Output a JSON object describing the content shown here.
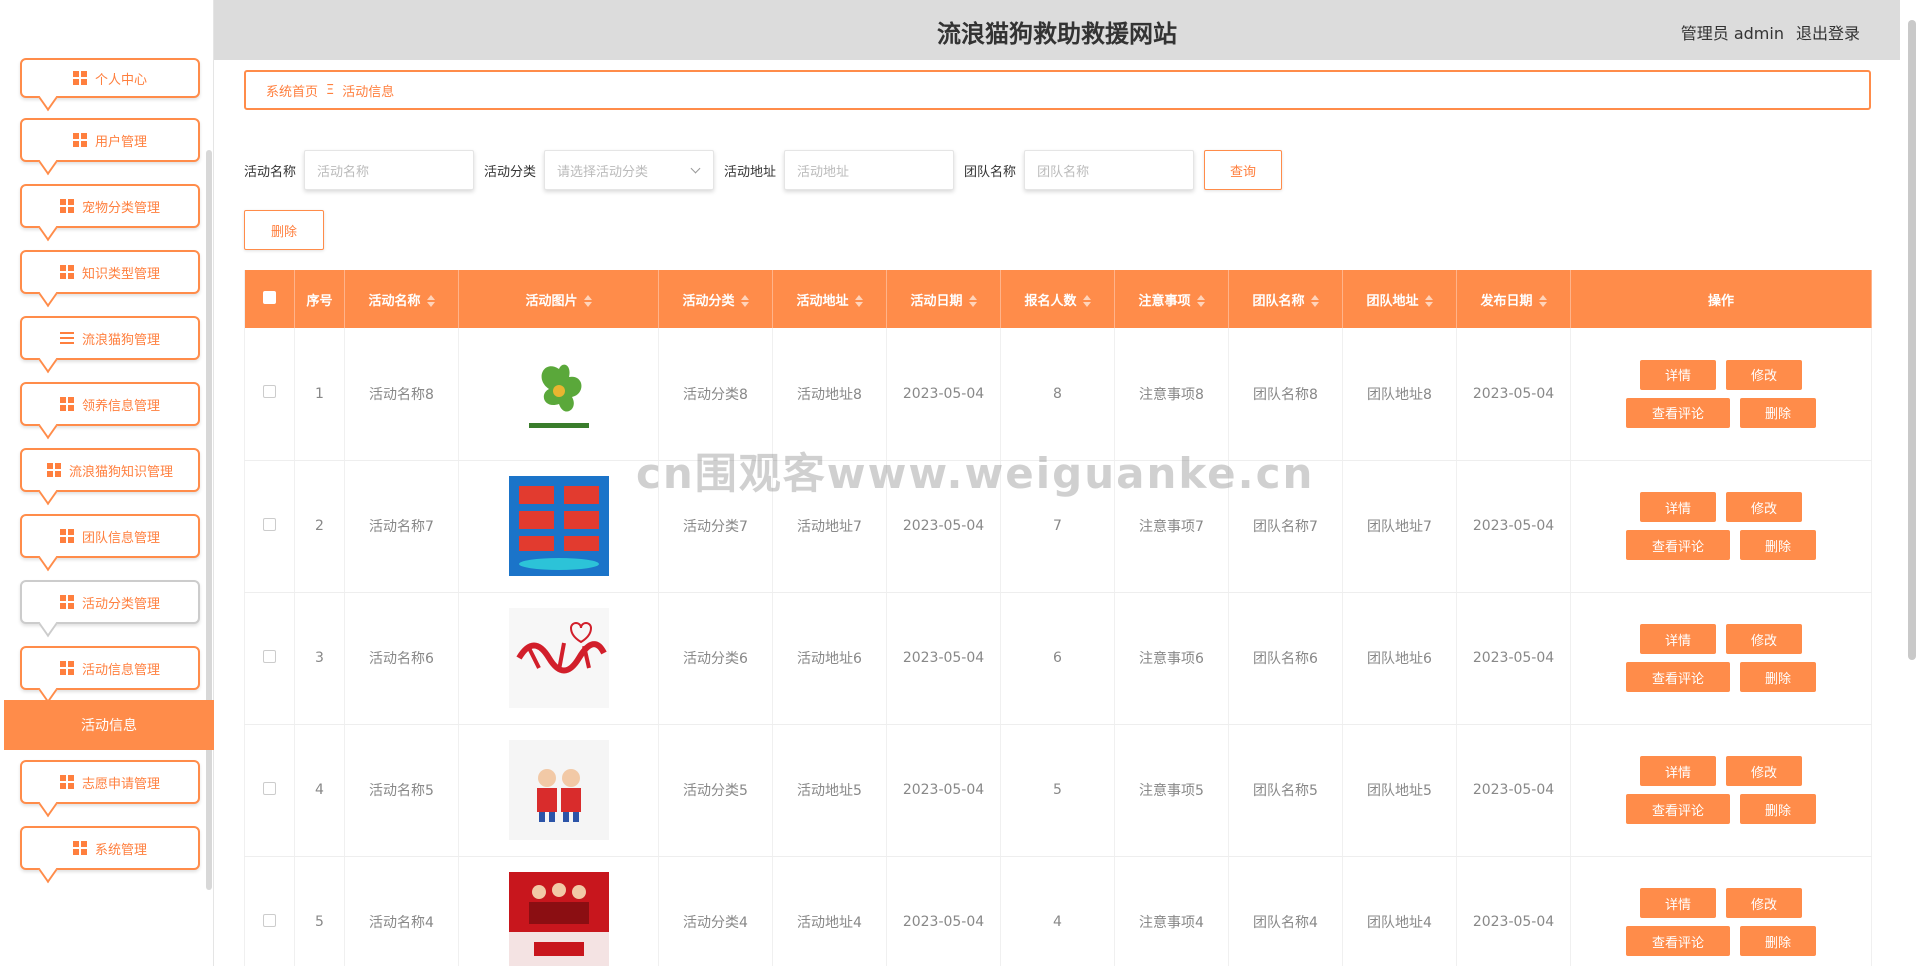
{
  "header": {
    "site_title": "流浪猫狗救助救援网站",
    "user": "管理员 admin",
    "logout": "退出登录"
  },
  "sidebar": {
    "items": [
      {
        "label": "个人中心",
        "icon": "user-icon"
      },
      {
        "label": "用户管理",
        "icon": "grid-icon"
      },
      {
        "label": "宠物分类管理",
        "icon": "grid-icon"
      },
      {
        "label": "知识类型管理",
        "icon": "grid-icon"
      },
      {
        "label": "流浪猫狗管理",
        "icon": "list-icon"
      },
      {
        "label": "领养信息管理",
        "icon": "clipboard-icon"
      },
      {
        "label": "流浪猫狗知识管理",
        "icon": "grid-icon"
      },
      {
        "label": "团队信息管理",
        "icon": "grid-icon"
      },
      {
        "label": "活动分类管理",
        "icon": "grid-icon"
      },
      {
        "label": "活动信息管理",
        "icon": "person-icon"
      },
      {
        "label": "志愿申请管理",
        "icon": "grid-icon"
      },
      {
        "label": "系统管理",
        "icon": "flag-icon"
      }
    ],
    "active_sub": "活动信息"
  },
  "breadcrumb": {
    "home": "系统首页",
    "sep": "Ξ",
    "current": "活动信息"
  },
  "search": {
    "name_label": "活动名称",
    "name_placeholder": "活动名称",
    "category_label": "活动分类",
    "category_placeholder": "请选择活动分类",
    "address_label": "活动地址",
    "address_placeholder": "活动地址",
    "team_label": "团队名称",
    "team_placeholder": "团队名称",
    "query": "查询",
    "delete": "删除"
  },
  "table": {
    "headers": [
      "序号",
      "活动名称",
      "活动图片",
      "活动分类",
      "活动地址",
      "活动日期",
      "报名人数",
      "注意事项",
      "团队名称",
      "团队地址",
      "发布日期",
      "操作"
    ],
    "rows": [
      {
        "no": "1",
        "name": "活动名称8",
        "category": "活动分类8",
        "address": "活动地址8",
        "date": "2023-05-04",
        "count": "8",
        "notes": "注意事项8",
        "team": "团队名称8",
        "team_addr": "团队地址8",
        "pub": "2023-05-04",
        "img": "beautiful-china-logo"
      },
      {
        "no": "2",
        "name": "活动名称7",
        "category": "活动分类7",
        "address": "活动地址7",
        "date": "2023-05-04",
        "count": "7",
        "notes": "注意事项7",
        "team": "团队名称7",
        "team_addr": "团队地址7",
        "pub": "2023-05-04",
        "img": "volunteer-board"
      },
      {
        "no": "3",
        "name": "活动名称6",
        "category": "活动分类6",
        "address": "活动地址6",
        "date": "2023-05-04",
        "count": "6",
        "notes": "注意事项6",
        "team": "团队名称6",
        "team_addr": "团队地址6",
        "pub": "2023-05-04",
        "img": "volunteer-calligraphy"
      },
      {
        "no": "4",
        "name": "活动名称5",
        "category": "活动分类5",
        "address": "活动地址5",
        "date": "2023-05-04",
        "count": "5",
        "notes": "注意事项5",
        "team": "团队名称5",
        "team_addr": "团队地址5",
        "pub": "2023-05-04",
        "img": "volunteers-cartoon"
      },
      {
        "no": "5",
        "name": "活动名称4",
        "category": "活动分类4",
        "address": "活动地址4",
        "date": "2023-05-04",
        "count": "4",
        "notes": "注意事项4",
        "team": "团队名称4",
        "team_addr": "团队地址4",
        "pub": "2023-05-04",
        "img": "volunteer-poster"
      }
    ],
    "ops": {
      "detail": "详情",
      "edit": "修改",
      "comments": "查看评论",
      "delete": "删除"
    }
  },
  "watermark": "cn围观客www.weiguanke.cn",
  "colors": {
    "accent": "#ff8c4a",
    "topbar": "#dcdcdc"
  }
}
